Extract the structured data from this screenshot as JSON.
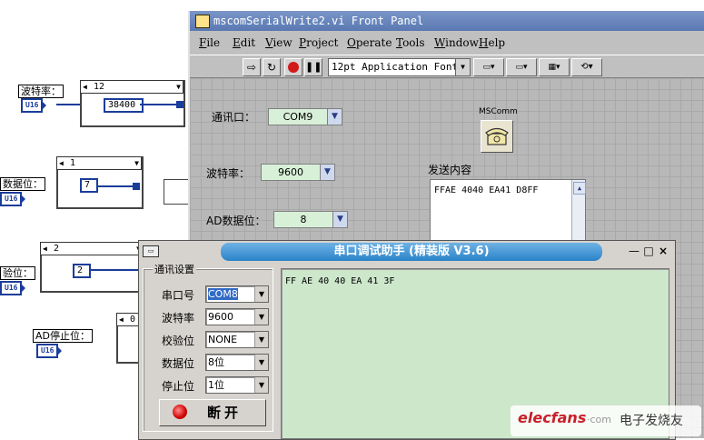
{
  "diagram": {
    "baud_label": "波特率：",
    "databits_label": "数据位：",
    "parity_label": "验位：",
    "stopbits_label": "AD停止位：",
    "type_tag": "U16",
    "case1_selector": "12",
    "case1_const": "38400",
    "case2_selector": "1",
    "case2_const": "7",
    "case3_selector": "2",
    "case3_const": "2",
    "case4_selector": "0"
  },
  "front_panel": {
    "title": "mscomSerialWrite2.vi Front Panel",
    "menu": [
      "File",
      "Edit",
      "View",
      "Project",
      "Operate",
      "Tools",
      "Window",
      "Help"
    ],
    "font_selector": "12pt Application Font",
    "port_label": "通讯口：",
    "port_value": "COM9",
    "baud_label": "波特率：",
    "baud_value": "9600",
    "databits_label": "AD数据位：",
    "databits_value": "8",
    "mscomm_label": "MSComm",
    "send_label": "发送内容",
    "send_value": "FFAE 4040 EA41 D8FF"
  },
  "serial_tool": {
    "title": "串口调试助手 (精装版 V3.6)",
    "group_label": "通讯设置",
    "fields": [
      {
        "label": "串口号",
        "value": "COM8"
      },
      {
        "label": "波特率",
        "value": "9600"
      },
      {
        "label": "校验位",
        "value": "NONE"
      },
      {
        "label": "数据位",
        "value": "8位"
      },
      {
        "label": "停止位",
        "value": "1位"
      }
    ],
    "button_label": "断开",
    "received": "FF AE 40 40 EA 41 3F",
    "min_glyph": "—",
    "max_glyph": "□",
    "close_glyph": "×"
  },
  "watermark": {
    "brand": "elecfans",
    "domain": "·com",
    "cn": "电子发烧友"
  }
}
